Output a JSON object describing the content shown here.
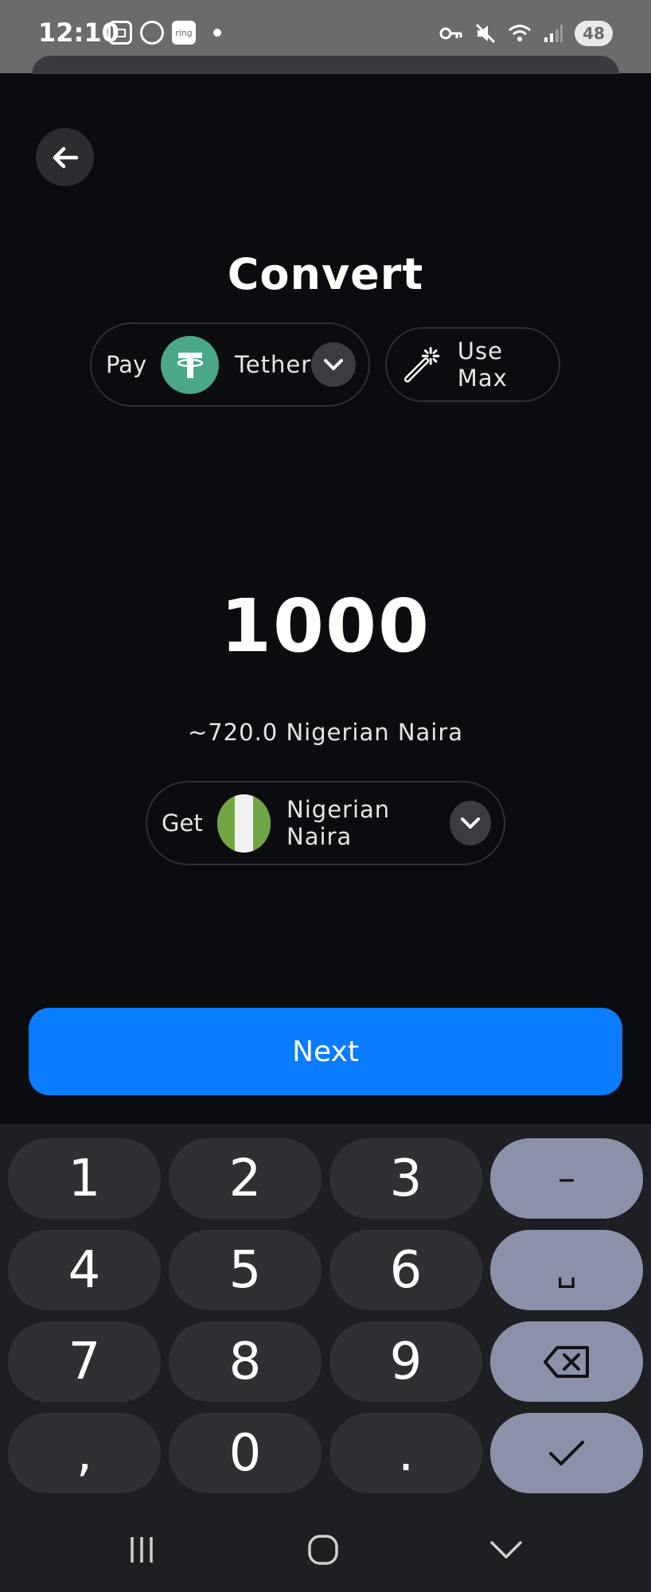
{
  "status_bar": {
    "time": "12:10",
    "ring_label": "ring",
    "battery": "48",
    "icons": [
      "screenshot-icon",
      "whatsapp-icon",
      "ring-icon",
      "notification-dot",
      "vpn-key-icon",
      "mute-icon",
      "wifi-icon",
      "signal-icon",
      "battery-icon"
    ]
  },
  "header": {
    "back_icon": "arrow-left-icon",
    "title": "Convert"
  },
  "pay": {
    "label": "Pay",
    "currency": "Tether",
    "icon": "tether-icon"
  },
  "use_max": {
    "label": "Use Max",
    "icon": "magic-wand-icon"
  },
  "amount": "1000",
  "estimate": "~720.0 Nigerian Naira",
  "get": {
    "label": "Get",
    "currency": "Nigerian Naira",
    "icon": "nigeria-flag-icon"
  },
  "next_button": "Next",
  "colors": {
    "background": "#0b0c10",
    "accent": "#0a7cff",
    "tether": "#4aa887",
    "keypad": "#1e1f22",
    "key": "#2f3033",
    "function_key": "#8a91a8"
  },
  "keypad": {
    "keys": [
      "1",
      "2",
      "3",
      "–",
      "4",
      "5",
      "6",
      "␣",
      "7",
      "8",
      "9",
      "backspace",
      ",",
      "0",
      ".",
      "done"
    ],
    "minus": "–",
    "space": "␣",
    "comma": ",",
    "period": "."
  },
  "navbar": {
    "icons": [
      "recent-apps-icon",
      "home-icon",
      "hide-keyboard-icon"
    ]
  }
}
